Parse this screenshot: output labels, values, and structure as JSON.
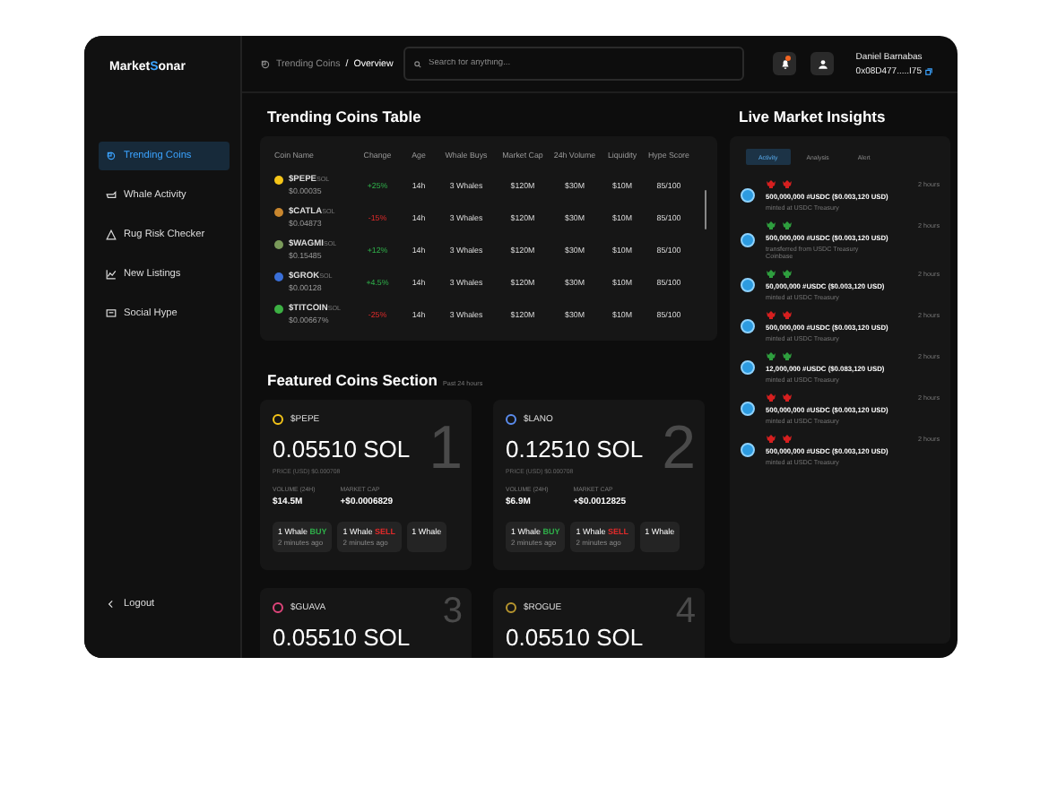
{
  "logo": [
    {
      "text": "Market",
      "accent": false
    },
    {
      "text": "S",
      "accent": true
    },
    {
      "text": "onar",
      "accent": false
    }
  ],
  "sidebar": {
    "items": [
      {
        "label": "Trending Coins",
        "selected": true
      },
      {
        "label": "Whale Activity",
        "selected": false
      },
      {
        "label": "Rug Risk Checker",
        "selected": false
      },
      {
        "label": "New Listings",
        "selected": false
      },
      {
        "label": "Social Hype",
        "selected": false
      }
    ],
    "logout": "Logout"
  },
  "header": {
    "breadcrumb": [
      {
        "label": "Trending Coins",
        "current": false
      },
      {
        "label": "Overview",
        "current": true
      }
    ],
    "separator": "/",
    "search": {
      "placeholder": "Search for anything..."
    },
    "notifications": {
      "unread": true
    },
    "user": {
      "name": "Daniel Barnabas",
      "address": "0x08D477.....I75"
    }
  },
  "table": {
    "title": "Trending Coins Table",
    "columns": [
      "Coin Name",
      "Change",
      "Age",
      "Whale Buys",
      "Market Cap",
      "24h Volume",
      "Liquidity",
      "Hype Score"
    ],
    "rows": [
      {
        "symbol": "$PEPE",
        "chain": "SOL",
        "price": "$0.00035",
        "color": "#f5c518",
        "change": "+25%",
        "kind": "gain",
        "age": "14h",
        "whale_buys": "3 Whales",
        "market_cap": "$120M",
        "volume": "$30M",
        "liquidity": "$10M",
        "hype": "85/100"
      },
      {
        "symbol": "$CATLA",
        "chain": "SOL",
        "price": "$0.04873",
        "color": "#c8862e",
        "change": "-15%",
        "kind": "loss",
        "age": "14h",
        "whale_buys": "3 Whales",
        "market_cap": "$120M",
        "volume": "$30M",
        "liquidity": "$10M",
        "hype": "85/100"
      },
      {
        "symbol": "$WAGMI",
        "chain": "SOL",
        "price": "$0.15485",
        "color": "#7a9a5a",
        "change": "+12%",
        "kind": "gain",
        "age": "14h",
        "whale_buys": "3 Whales",
        "market_cap": "$120M",
        "volume": "$30M",
        "liquidity": "$10M",
        "hype": "85/100"
      },
      {
        "symbol": "$GROK",
        "chain": "SOL",
        "price": "$0.00128",
        "color": "#3a6fd8",
        "change": "+4.5%",
        "kind": "gain",
        "age": "14h",
        "whale_buys": "3 Whales",
        "market_cap": "$120M",
        "volume": "$30M",
        "liquidity": "$10M",
        "hype": "85/100"
      },
      {
        "symbol": "$TITCOIN",
        "chain": "SOL",
        "price": "$0.00667%",
        "color": "#3cb043",
        "change": "-25%",
        "kind": "loss",
        "age": "14h",
        "whale_buys": "3 Whales",
        "market_cap": "$120M",
        "volume": "$30M",
        "liquidity": "$10M",
        "hype": "85/100"
      }
    ]
  },
  "featured": {
    "title": "Featured Coins Section",
    "subtitle": "Past 24 hours",
    "cards": [
      {
        "rank": "1",
        "symbol": "$PEPE",
        "color": "#f5c518",
        "price": "0.05510 SOL",
        "price_usd": "PRICE (USD) $0.000708",
        "volume_label": "VOLUME (24H)",
        "volume": "$14.5M",
        "cap_label": "MARKET CAP",
        "cap": "+$0.0006829",
        "trades": [
          {
            "whales": "1 Whale",
            "side": "BUY",
            "kind": "buy",
            "time": "2 minutes ago"
          },
          {
            "whales": "1 Whale",
            "side": "SELL",
            "kind": "sell",
            "time": "2 minutes ago"
          },
          {
            "whales": "1 Whale"
          }
        ]
      },
      {
        "rank": "2",
        "symbol": "$LANO",
        "color": "#5b8def",
        "price": "0.12510 SOL",
        "price_usd": "PRICE (USD) $0.000708",
        "volume_label": "VOLUME (24H)",
        "volume": "$6.9M",
        "cap_label": "MARKET CAP",
        "cap": "+$0.0012825",
        "trades": [
          {
            "whales": "1 Whale",
            "side": "BUY",
            "kind": "buy",
            "time": "2 minutes ago"
          },
          {
            "whales": "1 Whale",
            "side": "SELL",
            "kind": "sell",
            "time": "2 minutes ago"
          },
          {
            "whales": "1 Whale"
          }
        ]
      },
      {
        "rank": "3",
        "symbol": "$GUAVA",
        "color": "#e0457b",
        "price": "0.05510 SOL"
      },
      {
        "rank": "4",
        "symbol": "$ROGUE",
        "color": "#b8962e",
        "price": "0.05510 SOL"
      }
    ]
  },
  "insights": {
    "title": "Live Market Insights",
    "tabs": [
      {
        "label": "Activity",
        "selected": true
      },
      {
        "label": "Analysis",
        "selected": false
      },
      {
        "label": "Alert",
        "selected": false
      }
    ],
    "items": [
      {
        "kind": "bear",
        "time": "2 hours",
        "amount": "500,000,000 #USDC ($0.003,120 USD)",
        "note": "minted at USDC Treasury"
      },
      {
        "kind": "bull",
        "time": "2 hours",
        "amount": "500,000,000 #USDC ($0.003,120 USD)",
        "note": "transferred from USDC Treasury Coinbase"
      },
      {
        "kind": "bull",
        "time": "2 hours",
        "amount": "50,000,000 #USDC ($0.003,120 USD)",
        "note": "minted at USDC Treasury"
      },
      {
        "kind": "bear",
        "time": "2 hours",
        "amount": "500,000,000 #USDC ($0.003,120 USD)",
        "note": "minted at USDC Treasury"
      },
      {
        "kind": "bull",
        "time": "2 hours",
        "amount": "12,000,000 #USDC ($0.083,120 USD)",
        "note": "minted at USDC Treasury"
      },
      {
        "kind": "bear",
        "time": "2 hours",
        "amount": "500,000,000 #USDC ($0.003,120 USD)",
        "note": "minted at USDC Treasury"
      },
      {
        "kind": "bear",
        "time": "2 hours",
        "amount": "500,000,000 #USDC ($0.003,120 USD)",
        "note": "minted at USDC Treasury"
      }
    ]
  }
}
